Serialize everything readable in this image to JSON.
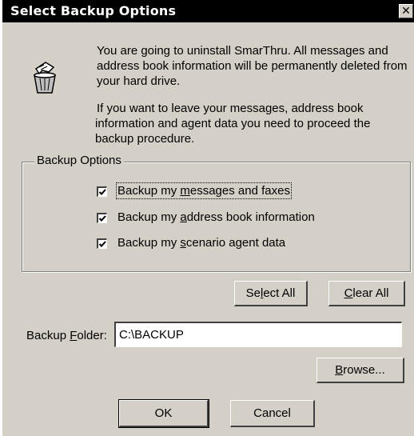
{
  "window": {
    "title": "Select Backup Options",
    "close_glyph": "✕"
  },
  "message": {
    "para1_line1": "You are going to uninstall SmarThru. All messages and",
    "para1_line2": "address book information will be permanently deleted from",
    "para1_line3": "your hard drive.",
    "para2_line1": "If you want to leave your messages, address book",
    "para2_line2": "information and agent data  you need to proceed the",
    "para2_line3": "backup procedure.",
    "icon": "uninstall-recycle-icon"
  },
  "backup_options": {
    "legend": "Backup Options",
    "items": [
      {
        "pre": "Backup my ",
        "accel": "m",
        "post": "essages and faxes",
        "checked": true
      },
      {
        "pre": "Backup my ",
        "accel": "a",
        "post": "ddress book information",
        "checked": true
      },
      {
        "pre": "Backup my ",
        "accel": "s",
        "post": "cenario agent data",
        "checked": true
      }
    ]
  },
  "buttons": {
    "select_all": {
      "pre": "Se",
      "accel": "l",
      "post": "ect All"
    },
    "clear_all": {
      "pre": "",
      "accel": "C",
      "post": "lear All"
    },
    "browse": {
      "pre": "",
      "accel": "B",
      "post": "rowse..."
    },
    "ok": "OK",
    "cancel": "Cancel"
  },
  "backup_folder": {
    "label_pre": "Backup ",
    "label_accel": "F",
    "label_post": "older:",
    "value": "C:\\BACKUP"
  },
  "colors": {
    "face": "#d4d0c8",
    "titlebar": "#000000",
    "shadow": "#404040"
  }
}
